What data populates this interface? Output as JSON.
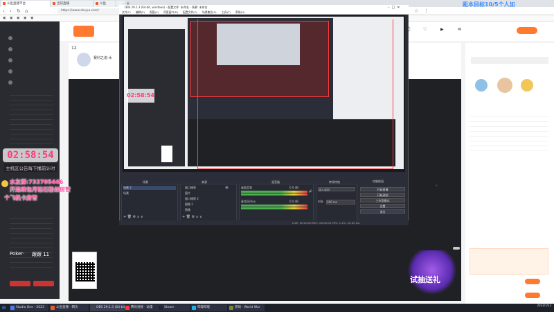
{
  "browser": {
    "tabs": [
      {
        "label": "斗鱼直播平台"
      },
      {
        "label": "当前直播"
      },
      {
        "label": "斗鱼"
      },
      {
        "label": "…"
      }
    ],
    "url": "https://www.douyu.com/",
    "banner_top": "距本目标10/5个人加"
  },
  "stream": {
    "timer": "02:58:54",
    "timer_sub": "主机区公告每下播前计时",
    "overlay_line1": "水友群:732705446",
    "overlay_line2": "开连续包月钻石粉丝房管",
    "overlay_line3": "个飞机卡房管",
    "poker_label": "Poker·",
    "poker_count": "跟跟 11",
    "room_number": "12",
    "room_title": "赛利之追·木"
  },
  "obs": {
    "title": "OBS 29.1.3 (64-bit, windows) - 配置文件: 未命名 - 场景: 未命名",
    "menu": [
      "文件(F)",
      "编辑(E)",
      "视图(V)",
      "停靠窗口(D)",
      "配置文件(P)",
      "场景集合(S)",
      "工具(T)",
      "帮助(H)"
    ],
    "docks": {
      "scenes": "场景",
      "sources": "来源",
      "mixer": "混音器",
      "transitions": "转场特效",
      "controls": "控制按钮"
    },
    "scenes": [
      "场景 2",
      "场景"
    ],
    "sources": [
      "窗口捕获",
      "图片",
      "窗口捕获 2",
      "图像 2",
      "图像"
    ],
    "mixer": [
      {
        "name": "桌面音频",
        "db": "0.0 dB"
      },
      {
        "name": "麦克风/Aux",
        "db": "0.0 dB"
      }
    ],
    "transition": "淡入淡出",
    "duration_label": "时长",
    "duration": "300 ms",
    "controls": [
      "开始直播",
      "开始录制",
      "工作室模式",
      "设置",
      "退出"
    ],
    "status": "LIVE: 00:00:00  REC: 00:00:00  CPU: 1.2%, 30.00 fps"
  },
  "promo": {
    "gift_text": "试抽送礼"
  },
  "taskbar": {
    "items": [
      {
        "label": "Studio One - 2023"
      },
      {
        "label": "斗鱼直播 - 网页"
      },
      {
        "label": "OBS 29.1.3 (64-bit)"
      },
      {
        "label": "腾讯视频 - 动漫"
      },
      {
        "label": "Steam"
      },
      {
        "label": "哔哩哔哩"
      },
      {
        "label": "游戏 - World War"
      }
    ],
    "time": "2023/7/23"
  }
}
